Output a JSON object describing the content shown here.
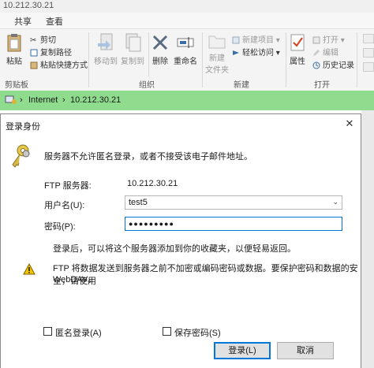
{
  "window": {
    "title": "10.212.30.21"
  },
  "ribbon_tabs": [
    "共享",
    "查看"
  ],
  "ribbon": {
    "clipboard": {
      "paste": "粘贴",
      "cut": "剪切",
      "copy_path": "复制路径",
      "paste_shortcut": "粘贴快捷方式",
      "group": "剪贴板"
    },
    "organize": {
      "move_to": "移动到",
      "copy_to": "复制到",
      "delete": "删除",
      "rename": "重命名",
      "group": "组织"
    },
    "new": {
      "new_folder": "新建\n文件夹",
      "new_item": "新建项目",
      "easy_access": "轻松访问",
      "group": "新建"
    },
    "open": {
      "properties": "属性",
      "open": "打开",
      "edit": "编辑",
      "history": "历史记录",
      "group": "打开"
    }
  },
  "address": {
    "root": "Internet",
    "host": "10.212.30.21"
  },
  "dialog": {
    "title": "登录身份",
    "message": "服务器不允许匿名登录，或者不接受该电子邮件地址。",
    "ftp_server_label": "FTP 服务器:",
    "ftp_server_value": "10.212.30.21",
    "username_label": "用户名(U):",
    "username_value": "test5",
    "password_label": "密码(P):",
    "password_value": "●●●●●●●●●",
    "info_text": "登录后，可以将这个服务器添加到你的收藏夹，以便轻易返回。",
    "warning_text_1": "FTP 将数据发送到服务器之前不加密或编码密码或数据。要保护密码和数据的安全，请使用",
    "warning_text_2": "WebDAV。",
    "anonymous_label": "匿名登录(A)",
    "save_password_label": "保存密码(S)",
    "login_button": "登录(L)",
    "cancel_button": "取消"
  },
  "colors": {
    "address_bar": "#8fdc8f",
    "default_button_border": "#0078d7",
    "warning_yellow": "#f5c400"
  }
}
